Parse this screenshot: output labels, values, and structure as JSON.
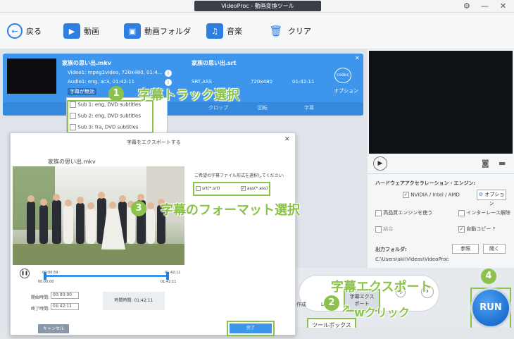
{
  "titlebar": {
    "title": "VideoProc - 動画変換ツール"
  },
  "toolbar": {
    "back": "戻る",
    "video": "動画",
    "video_folder": "動画フォルダ",
    "music": "音楽",
    "clear": "クリア"
  },
  "task": {
    "source_name": "家族の思い出.mkv",
    "video_info": "Video1: mpeg2video, 720x480, 01:4...",
    "audio_info": "Audio1: eng, ac3, 01:42:11",
    "subtitle_state": "字幕が無効",
    "output_name": "家族の思い出.srt",
    "output_format": "SRT,ASS",
    "output_res": "720x480",
    "output_time": "01:42:11",
    "codec_label": "codec",
    "option_label": "オプション",
    "subtitle_options": [
      "Sub 1: eng, DVD subtitles",
      "Sub 2: eng, DVD subtitles",
      "Sub 3: fra, DVD subtitles"
    ],
    "edit_tabs": [
      "クロップ",
      "回転",
      "字幕"
    ]
  },
  "dialog": {
    "title": "字幕をエクスポートする",
    "video_name": "家族の思い出.mkv",
    "format_prompt": "ご希望の字幕ファイル形式を選択してください:",
    "format_srt": "srt(*.srt)",
    "format_ass": "ass(*.ass)",
    "time_start": "00:00:59",
    "time_total": "01:42:11",
    "time_pos": "00:00:00",
    "time_end_small": "01:42:11",
    "start_label": "開始時間:",
    "start_value": "00:00:00",
    "end_label": "終了時間:",
    "end_value": "01:42:11",
    "duration_label": "時間時間: 01:42:11",
    "cancel": "キャンセル",
    "done": "完了"
  },
  "right": {
    "hw_title": "ハードウェアアクセラレーション・エンジン:",
    "hw_vendor": "NVIDIA / Intel / AMD",
    "hw_option": "オプション",
    "quality": "高品質エンジンを使う",
    "deinterlace": "インターレース解除",
    "merge": "結合",
    "autocopy": "自動コピー ?",
    "output_folder_label": "出力フォルダ:",
    "browse": "参照",
    "open": "開く",
    "output_path": "C:\\Users\\aki\\Videos\\VideoProc",
    "run": "RUN"
  },
  "bottom": {
    "toolbox": "ツールボックス",
    "export_tile": "字幕エクス\nポート",
    "tile_left_label": "作成",
    "tile_left2": "レ"
  },
  "annotations": {
    "n1": "1",
    "a1": "字幕トラック選択",
    "n2": "2",
    "a2": "字幕エクスポート",
    "a2b": "wクリック",
    "n3": "3",
    "a3": "字幕のフォーマット選択",
    "n4": "4"
  },
  "colors": {
    "accent": "#3d95ec",
    "annotation": "#8bc34a",
    "run": "#1e6fd0"
  }
}
